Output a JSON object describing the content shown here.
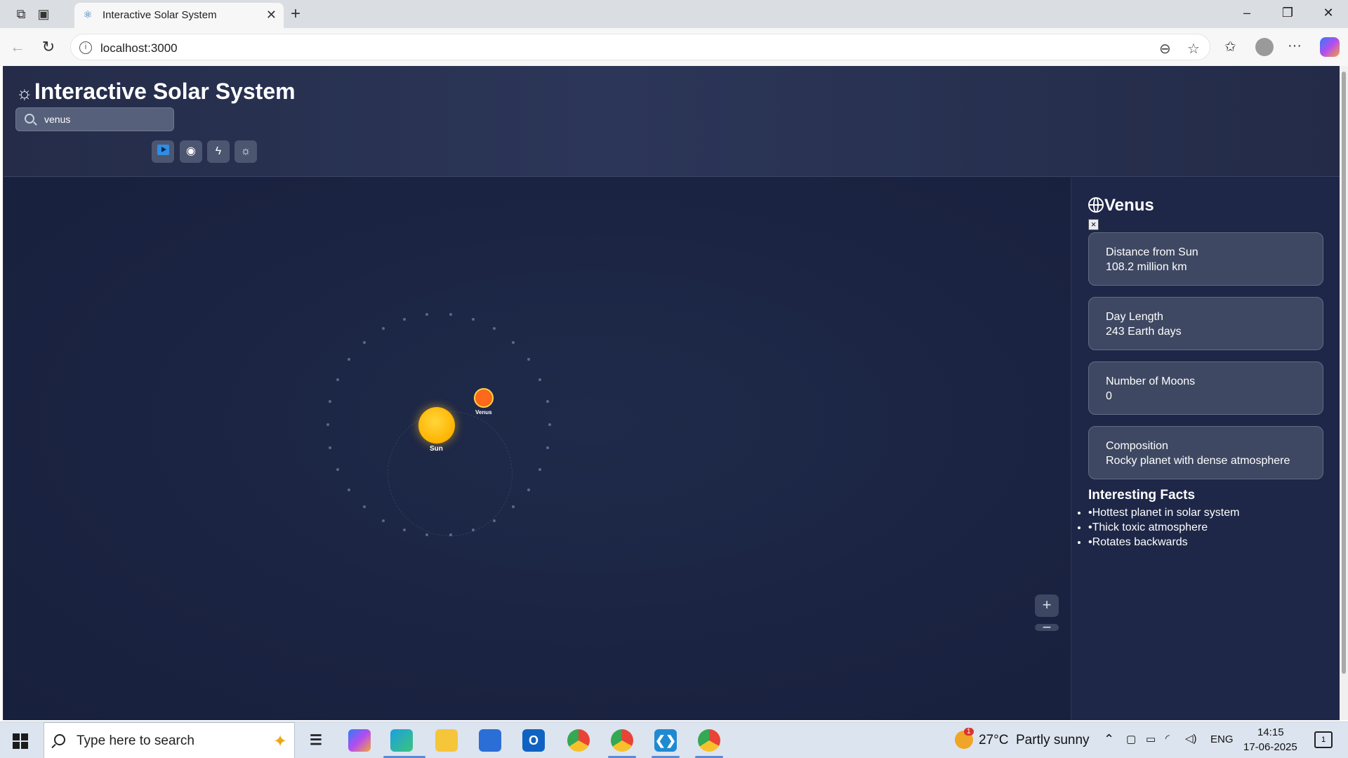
{
  "browser": {
    "tab_title": "Interactive Solar System",
    "url": "localhost:3000"
  },
  "header": {
    "title": "Interactive Solar System",
    "search_value": "venus",
    "toolbar_icons": [
      "play-icon",
      "eye-icon",
      "lightning-icon",
      "sun-icon"
    ]
  },
  "canvas": {
    "sun_label": "Sun",
    "planet_label": "Venus",
    "sun_color": "#ffb300",
    "venus_color": "#ff6a1a",
    "zoom_in": "+",
    "zoom_out": "−"
  },
  "panel": {
    "title": "Venus",
    "close": "×",
    "cards": [
      {
        "label": "Distance from Sun",
        "value": "108.2 million km"
      },
      {
        "label": "Day Length",
        "value": "243 Earth days"
      },
      {
        "label": "Number of Moons",
        "value": "0"
      },
      {
        "label": "Composition",
        "value": "Rocky planet with dense atmosphere"
      }
    ],
    "facts_title": "Interesting Facts",
    "facts": [
      "•Hottest planet in solar system",
      "•Thick toxic atmosphere",
      "•Rotates backwards"
    ]
  },
  "taskbar": {
    "search_placeholder": "Type here to search",
    "weather": "27°C  Partly sunny",
    "weather_badge": "1",
    "language": "ENG",
    "time": "14:15",
    "date": "17-06-2025",
    "notifications": "1"
  }
}
